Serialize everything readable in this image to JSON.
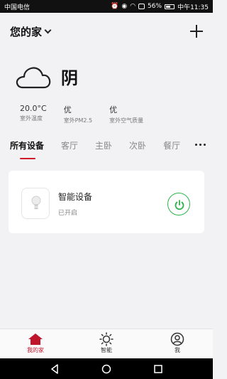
{
  "status_bar": {
    "carrier": "中国电信",
    "battery": "56%",
    "time": "中午11:35"
  },
  "header": {
    "home_name": "您的家",
    "add_icon": "plus-icon"
  },
  "weather": {
    "icon": "cloud-icon",
    "condition": "阴",
    "stats": [
      {
        "value": "20.0°C",
        "label": "室外温度"
      },
      {
        "value": "优",
        "label": "室外PM2.5"
      },
      {
        "value": "优",
        "label": "室外空气质量"
      }
    ]
  },
  "tabs": [
    "所有设备",
    "客厅",
    "主卧",
    "次卧",
    "餐厅"
  ],
  "device": {
    "name": "智能设备",
    "status": "已开启",
    "icon": "lightbulb-icon"
  },
  "bottom_nav": [
    {
      "label": "我的家",
      "icon": "home-icon"
    },
    {
      "label": "智能",
      "icon": "sun-icon"
    },
    {
      "label": "我",
      "icon": "user-icon"
    }
  ],
  "colors": {
    "accent_red": "#c0162b",
    "power_green": "#2eb34a"
  }
}
